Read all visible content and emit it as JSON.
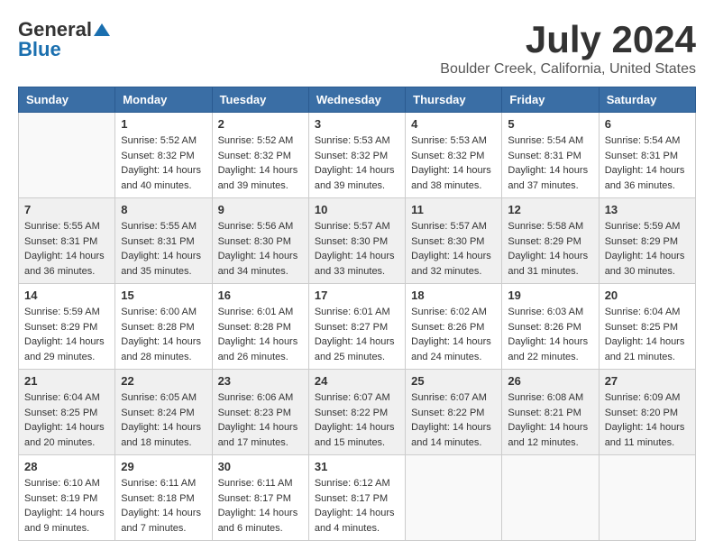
{
  "header": {
    "logo_general": "General",
    "logo_blue": "Blue",
    "month": "July 2024",
    "location": "Boulder Creek, California, United States"
  },
  "days_of_week": [
    "Sunday",
    "Monday",
    "Tuesday",
    "Wednesday",
    "Thursday",
    "Friday",
    "Saturday"
  ],
  "weeks": [
    [
      {
        "day": "",
        "content": ""
      },
      {
        "day": "1",
        "content": "Sunrise: 5:52 AM\nSunset: 8:32 PM\nDaylight: 14 hours\nand 40 minutes."
      },
      {
        "day": "2",
        "content": "Sunrise: 5:52 AM\nSunset: 8:32 PM\nDaylight: 14 hours\nand 39 minutes."
      },
      {
        "day": "3",
        "content": "Sunrise: 5:53 AM\nSunset: 8:32 PM\nDaylight: 14 hours\nand 39 minutes."
      },
      {
        "day": "4",
        "content": "Sunrise: 5:53 AM\nSunset: 8:32 PM\nDaylight: 14 hours\nand 38 minutes."
      },
      {
        "day": "5",
        "content": "Sunrise: 5:54 AM\nSunset: 8:31 PM\nDaylight: 14 hours\nand 37 minutes."
      },
      {
        "day": "6",
        "content": "Sunrise: 5:54 AM\nSunset: 8:31 PM\nDaylight: 14 hours\nand 36 minutes."
      }
    ],
    [
      {
        "day": "7",
        "content": "Sunrise: 5:55 AM\nSunset: 8:31 PM\nDaylight: 14 hours\nand 36 minutes."
      },
      {
        "day": "8",
        "content": "Sunrise: 5:55 AM\nSunset: 8:31 PM\nDaylight: 14 hours\nand 35 minutes."
      },
      {
        "day": "9",
        "content": "Sunrise: 5:56 AM\nSunset: 8:30 PM\nDaylight: 14 hours\nand 34 minutes."
      },
      {
        "day": "10",
        "content": "Sunrise: 5:57 AM\nSunset: 8:30 PM\nDaylight: 14 hours\nand 33 minutes."
      },
      {
        "day": "11",
        "content": "Sunrise: 5:57 AM\nSunset: 8:30 PM\nDaylight: 14 hours\nand 32 minutes."
      },
      {
        "day": "12",
        "content": "Sunrise: 5:58 AM\nSunset: 8:29 PM\nDaylight: 14 hours\nand 31 minutes."
      },
      {
        "day": "13",
        "content": "Sunrise: 5:59 AM\nSunset: 8:29 PM\nDaylight: 14 hours\nand 30 minutes."
      }
    ],
    [
      {
        "day": "14",
        "content": "Sunrise: 5:59 AM\nSunset: 8:29 PM\nDaylight: 14 hours\nand 29 minutes."
      },
      {
        "day": "15",
        "content": "Sunrise: 6:00 AM\nSunset: 8:28 PM\nDaylight: 14 hours\nand 28 minutes."
      },
      {
        "day": "16",
        "content": "Sunrise: 6:01 AM\nSunset: 8:28 PM\nDaylight: 14 hours\nand 26 minutes."
      },
      {
        "day": "17",
        "content": "Sunrise: 6:01 AM\nSunset: 8:27 PM\nDaylight: 14 hours\nand 25 minutes."
      },
      {
        "day": "18",
        "content": "Sunrise: 6:02 AM\nSunset: 8:26 PM\nDaylight: 14 hours\nand 24 minutes."
      },
      {
        "day": "19",
        "content": "Sunrise: 6:03 AM\nSunset: 8:26 PM\nDaylight: 14 hours\nand 22 minutes."
      },
      {
        "day": "20",
        "content": "Sunrise: 6:04 AM\nSunset: 8:25 PM\nDaylight: 14 hours\nand 21 minutes."
      }
    ],
    [
      {
        "day": "21",
        "content": "Sunrise: 6:04 AM\nSunset: 8:25 PM\nDaylight: 14 hours\nand 20 minutes."
      },
      {
        "day": "22",
        "content": "Sunrise: 6:05 AM\nSunset: 8:24 PM\nDaylight: 14 hours\nand 18 minutes."
      },
      {
        "day": "23",
        "content": "Sunrise: 6:06 AM\nSunset: 8:23 PM\nDaylight: 14 hours\nand 17 minutes."
      },
      {
        "day": "24",
        "content": "Sunrise: 6:07 AM\nSunset: 8:22 PM\nDaylight: 14 hours\nand 15 minutes."
      },
      {
        "day": "25",
        "content": "Sunrise: 6:07 AM\nSunset: 8:22 PM\nDaylight: 14 hours\nand 14 minutes."
      },
      {
        "day": "26",
        "content": "Sunrise: 6:08 AM\nSunset: 8:21 PM\nDaylight: 14 hours\nand 12 minutes."
      },
      {
        "day": "27",
        "content": "Sunrise: 6:09 AM\nSunset: 8:20 PM\nDaylight: 14 hours\nand 11 minutes."
      }
    ],
    [
      {
        "day": "28",
        "content": "Sunrise: 6:10 AM\nSunset: 8:19 PM\nDaylight: 14 hours\nand 9 minutes."
      },
      {
        "day": "29",
        "content": "Sunrise: 6:11 AM\nSunset: 8:18 PM\nDaylight: 14 hours\nand 7 minutes."
      },
      {
        "day": "30",
        "content": "Sunrise: 6:11 AM\nSunset: 8:17 PM\nDaylight: 14 hours\nand 6 minutes."
      },
      {
        "day": "31",
        "content": "Sunrise: 6:12 AM\nSunset: 8:17 PM\nDaylight: 14 hours\nand 4 minutes."
      },
      {
        "day": "",
        "content": ""
      },
      {
        "day": "",
        "content": ""
      },
      {
        "day": "",
        "content": ""
      }
    ]
  ]
}
